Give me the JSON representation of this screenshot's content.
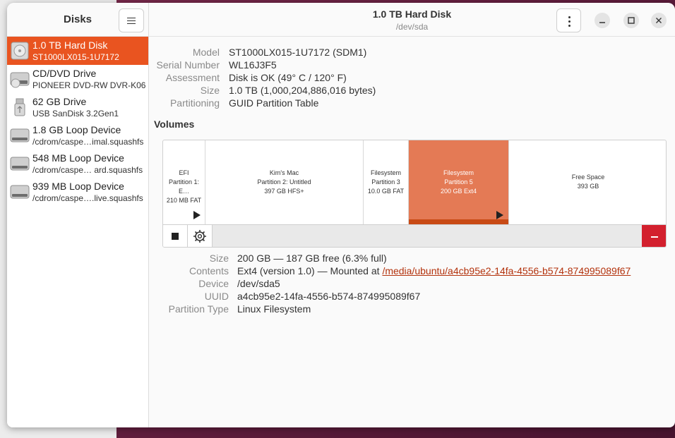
{
  "sidebar": {
    "title": "Disks",
    "devices": [
      {
        "name": "1.0 TB Hard Disk",
        "sub": "ST1000LX015-1U7172",
        "icon": "hard-disk-icon",
        "selected": true
      },
      {
        "name": "CD/DVD Drive",
        "sub": "PIONEER DVD-RW  DVR-K06",
        "icon": "optical-drive-icon"
      },
      {
        "name": "62 GB Drive",
        "sub": "USB SanDisk 3.2Gen1",
        "icon": "usb-drive-icon"
      },
      {
        "name": "1.8 GB Loop Device",
        "sub": "/cdrom/caspe…imal.squashfs",
        "icon": "loop-device-icon"
      },
      {
        "name": "548 MB Loop Device",
        "sub": "/cdrom/caspe… ard.squashfs",
        "icon": "loop-device-icon"
      },
      {
        "name": "939 MB Loop Device",
        "sub": "/cdrom/caspe….live.squashfs",
        "icon": "loop-device-icon"
      }
    ]
  },
  "header": {
    "title": "1.0 TB Hard Disk",
    "subtitle": "/dev/sda"
  },
  "disk_info": [
    {
      "label": "Model",
      "value": "ST1000LX015-1U7172 (SDM1)"
    },
    {
      "label": "Serial Number",
      "value": "WL16J3F5"
    },
    {
      "label": "Assessment",
      "value": "Disk is OK (49° C / 120° F)"
    },
    {
      "label": "Size",
      "value": "1.0 TB (1,000,204,886,016 bytes)"
    },
    {
      "label": "Partitioning",
      "value": "GUID Partition Table"
    }
  ],
  "volumes": {
    "title": "Volumes",
    "partitions": [
      {
        "line1": "EFI",
        "line2": "Partition 1: E…",
        "line3": "210 MB FAT"
      },
      {
        "line1": "Kim's Mac",
        "line2": "Partition 2: Untitled",
        "line3": "397 GB HFS+"
      },
      {
        "line1": "Filesystem",
        "line2": "Partition 3",
        "line3": "10.0 GB FAT"
      },
      {
        "line1": "Filesystem",
        "line2": "Partition 5",
        "line3": "200 GB Ext4",
        "selected": true
      },
      {
        "line1": "Free Space",
        "line2": "393 GB",
        "line3": ""
      }
    ]
  },
  "partition_info": {
    "size_label": "Size",
    "size_value": "200 GB — 187 GB free (6.3% full)",
    "contents_label": "Contents",
    "contents_prefix": "Ext4 (version 1.0) — Mounted at ",
    "contents_link": "/media/ubuntu/a4cb95e2-14fa-4556-b574-874995089f67",
    "device_label": "Device",
    "device_value": "/dev/sda5",
    "uuid_label": "UUID",
    "uuid_value": "a4cb95e2-14fa-4556-b574-874995089f67",
    "type_label": "Partition Type",
    "type_value": "Linux Filesystem"
  },
  "colors": {
    "accent": "#e95420",
    "selected_partition": "#e47a55",
    "delete": "#d3202e"
  }
}
